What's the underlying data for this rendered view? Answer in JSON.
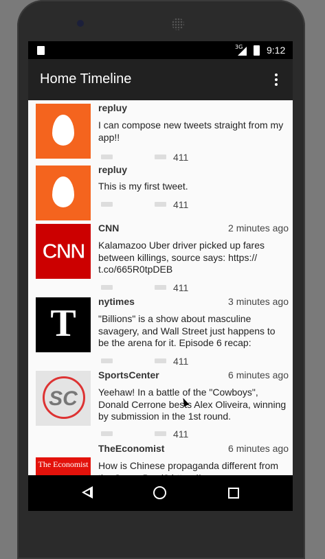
{
  "status_bar": {
    "network": "3G",
    "time": "9:12"
  },
  "app_bar": {
    "title": "Home Timeline"
  },
  "tweets": [
    {
      "user": "repluy",
      "time": "",
      "text": "I can compose new tweets straight from my app!!",
      "count": "411",
      "avatar": "egg-icon"
    },
    {
      "user": "repluy",
      "time": "",
      "text": "This is my first tweet.",
      "count": "411",
      "avatar": "egg-icon"
    },
    {
      "user": "CNN",
      "time": "2 minutes ago",
      "text": "Kalamazoo Uber driver picked up fares between killings, source says: https:// t.co/665R0tpDEB",
      "count": "411",
      "avatar_text": "CNN"
    },
    {
      "user": "nytimes",
      "time": "3 minutes ago",
      "text": "\"Billions\" is a show about masculine savagery, and Wall Street just happens to be the arena for it. Episode 6 recap:",
      "count": "411",
      "avatar_text": "T"
    },
    {
      "user": "SportsCenter",
      "time": "6 minutes ago",
      "text": "Yeehaw! In a battle of the \"Cowboys\", Donald Cerrone bests Alex Oliveira, winning by submission in the 1st round.",
      "count": "411",
      "avatar_text": "SC"
    },
    {
      "user": "TheEconomist",
      "time": "6 minutes ago",
      "text": "How is Chinese propaganda different from the Super Bowl? https://",
      "count": "",
      "avatar_text": "The Economist"
    }
  ],
  "colors": {
    "app_bar": "#212121",
    "egg_avatar": "#f4641e",
    "cnn_red": "#cc0000"
  }
}
